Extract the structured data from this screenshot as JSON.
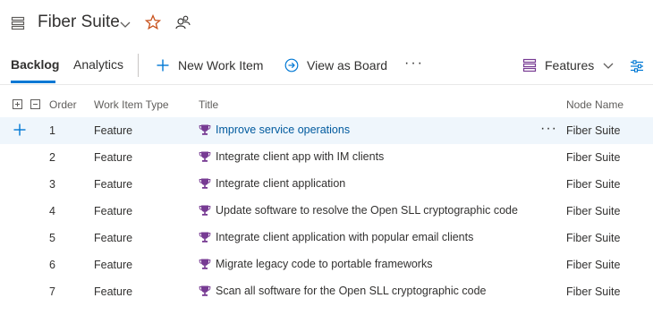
{
  "header": {
    "title": "Fiber Suite",
    "icons": [
      "board-icon",
      "chevron-down-icon",
      "star-icon",
      "team-icon"
    ]
  },
  "toolbar": {
    "tabs": [
      {
        "label": "Backlog",
        "active": true
      },
      {
        "label": "Analytics",
        "active": false
      }
    ],
    "new_work_item_label": "New Work Item",
    "view_as_board_label": "View as Board",
    "more_label": "···",
    "level_select_label": "Features"
  },
  "columns": {
    "order": "Order",
    "type": "Work Item Type",
    "title": "Title",
    "node": "Node Name"
  },
  "rows": [
    {
      "order": "1",
      "type": "Feature",
      "title": "Improve service operations",
      "node": "Fiber Suite",
      "selected": true
    },
    {
      "order": "2",
      "type": "Feature",
      "title": "Integrate client app with IM clients",
      "node": "Fiber Suite"
    },
    {
      "order": "3",
      "type": "Feature",
      "title": "Integrate client application",
      "node": "Fiber Suite"
    },
    {
      "order": "4",
      "type": "Feature",
      "title": "Update software to resolve the Open SLL cryptographic code",
      "node": "Fiber Suite"
    },
    {
      "order": "5",
      "type": "Feature",
      "title": "Integrate client application with popular email clients",
      "node": "Fiber Suite"
    },
    {
      "order": "6",
      "type": "Feature",
      "title": "Migrate legacy code to portable frameworks",
      "node": "Fiber Suite"
    },
    {
      "order": "7",
      "type": "Feature",
      "title": "Scan all software for the Open SLL cryptographic code",
      "node": "Fiber Suite"
    }
  ],
  "colors": {
    "accent": "#0078d4",
    "feature_icon": "#773b93",
    "selected_row": "#eff6fc",
    "star": "#c8511b"
  }
}
